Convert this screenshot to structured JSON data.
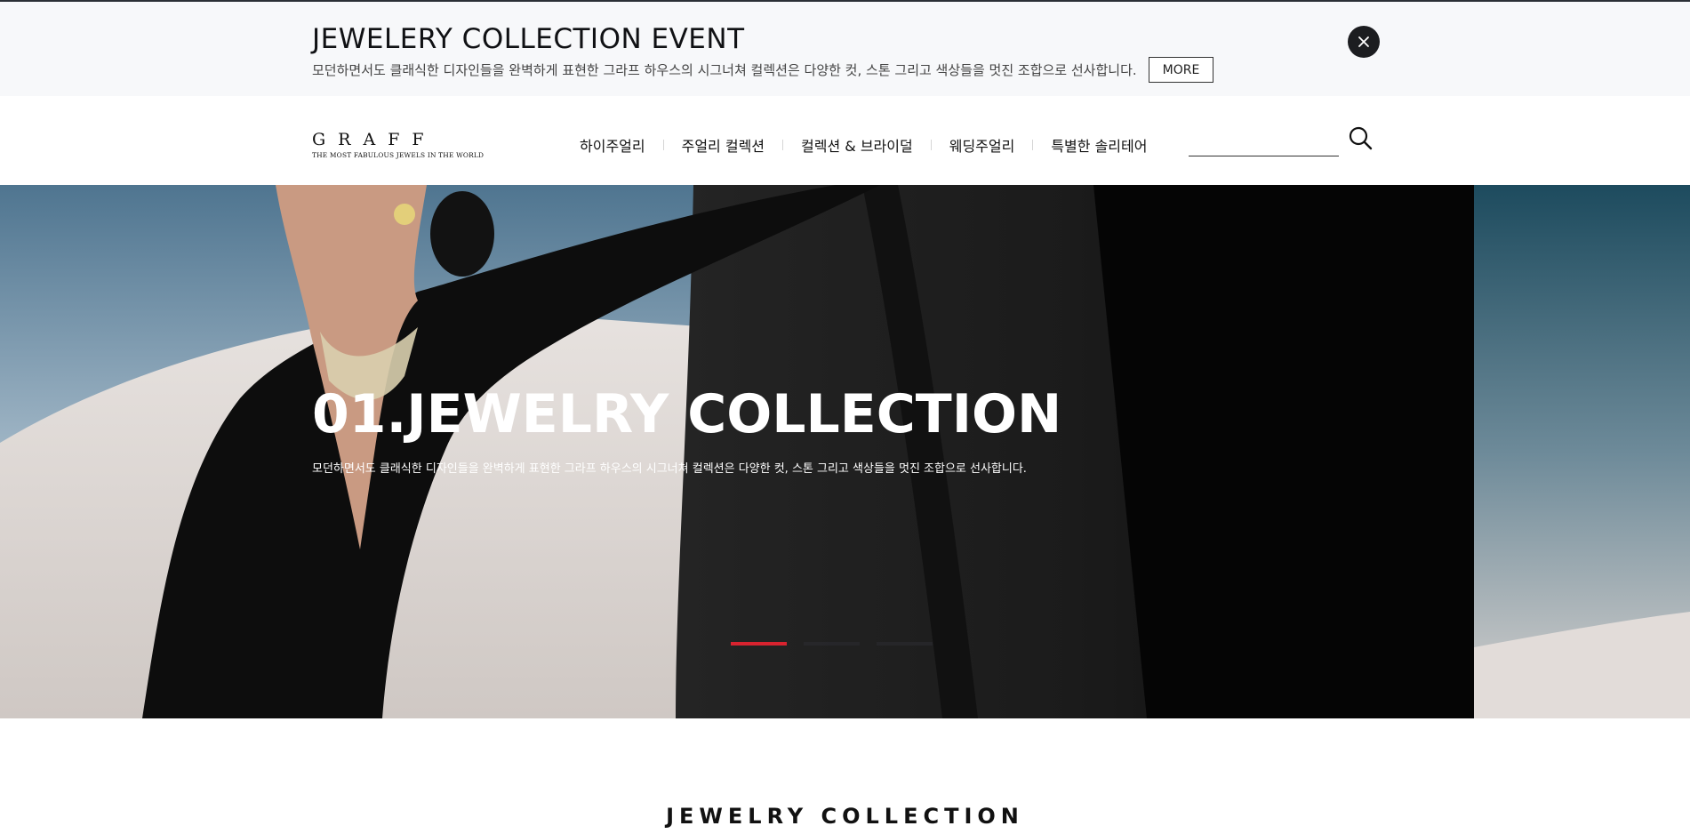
{
  "event_banner": {
    "title": "JEWELERY COLLECTION EVENT",
    "description": "모던하면서도 클래식한 디자인들을 완벽하게 표현한 그라프 하우스의 시그너쳐 컬렉션은 다양한 컷, 스톤 그리고 색상들을 멋진 조합으로 선사합니다.",
    "more_label": "MORE",
    "close_icon": "close-icon"
  },
  "header": {
    "logo": {
      "wordmark": "GRAFF",
      "tagline": "THE MOST FABULOUS JEWELS IN THE WORLD"
    },
    "nav": [
      {
        "label": "하이주얼리"
      },
      {
        "label": "주얼리 컬렉션"
      },
      {
        "label": "컬렉션 & 브라이덜"
      },
      {
        "label": "웨딩주얼리"
      },
      {
        "label": "특별한 솔리테어"
      }
    ],
    "search": {
      "value": "",
      "placeholder": "",
      "icon": "search-icon"
    }
  },
  "hero": {
    "title": "01.JEWELRY COLLECTION",
    "description": "모던하면서도 클래식한 디자인들을 완벽하게 표현한 그라프 하우스의 시그너쳐 컬렉션은 다양한 컷, 스톤 그리고 색상들을 멋진 조합으로 선사합니다.",
    "slides_total": 3,
    "active_slide": 1
  },
  "section": {
    "title": "JEWELRY COLLECTION"
  },
  "colors": {
    "banner_bg": "#f7f8fa",
    "accent_red": "#d8232f",
    "dark": "#1c1d20"
  }
}
